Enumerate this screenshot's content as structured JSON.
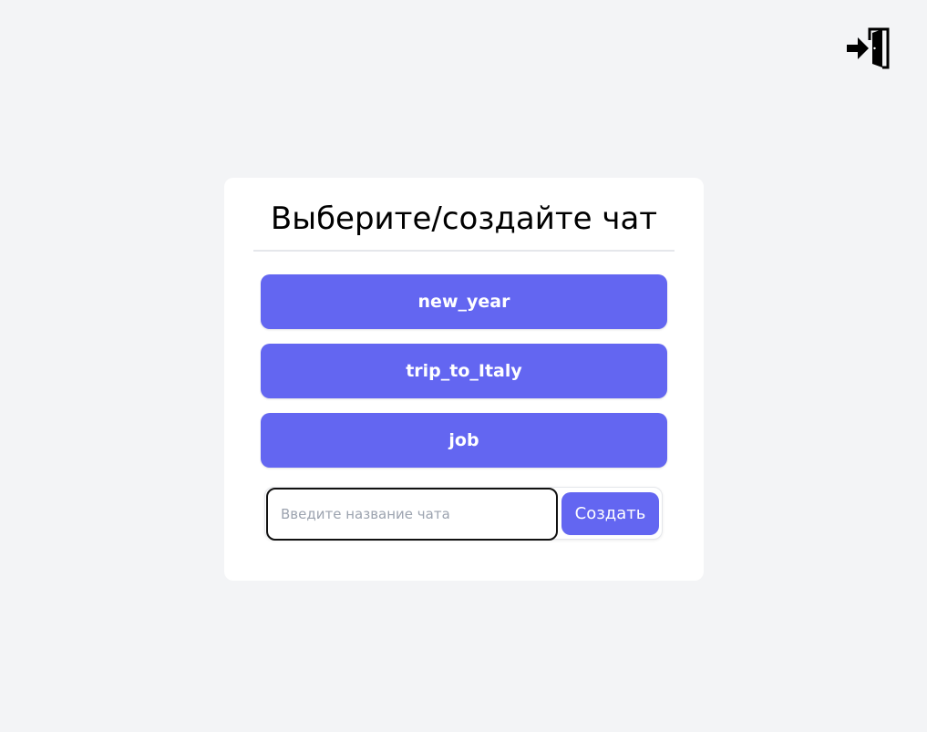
{
  "header": {
    "logout_icon": "logout-door-icon"
  },
  "card": {
    "title": "Выберите/создайте чат",
    "chats": [
      {
        "label": "new_year"
      },
      {
        "label": "trip_to_Italy"
      },
      {
        "label": "job"
      }
    ],
    "create": {
      "input_value": "",
      "input_placeholder": "Введите название чата",
      "button_label": "Создать"
    }
  },
  "colors": {
    "accent": "#6366f1",
    "background": "#f3f4f6",
    "card": "#ffffff"
  }
}
